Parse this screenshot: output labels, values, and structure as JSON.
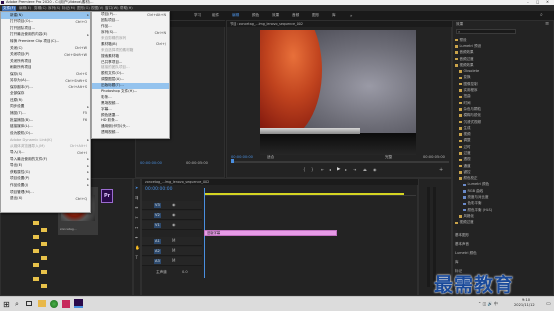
{
  "titlebar": {
    "title": "Adobe Premiere Pro 2020 - C:\\用户\\Videos\\素材\\..."
  },
  "menubar": {
    "items": [
      "文件(F)",
      "编辑(E)",
      "剪辑(C)",
      "序列(S)",
      "标记(M)",
      "图形(G)",
      "视图(V)",
      "窗口(W)",
      "帮助(H)"
    ]
  },
  "workspaces": [
    "学习",
    "组件",
    "编辑",
    "颜色",
    "效果",
    "音频",
    "图形",
    "库"
  ],
  "file_menu": {
    "items": [
      {
        "label": "新建(N)",
        "shortcut": "",
        "arrow": true,
        "hl": true
      },
      {
        "label": "打开项目(O)...",
        "shortcut": "Ctrl+O"
      },
      {
        "label": "打开团队项目...",
        "shortcut": ""
      },
      {
        "label": "打开最近使用的内容(E)",
        "shortcut": "",
        "arrow": true
      },
      {
        "label": "转换 Premiere Clip 项目(C)...",
        "shortcut": ""
      },
      {
        "label": "关闭(C)",
        "shortcut": "Ctrl+W"
      },
      {
        "label": "关闭项目(P)",
        "shortcut": "Ctrl+Shift+W"
      },
      {
        "label": "关闭所有项目",
        "shortcut": ""
      },
      {
        "label": "刷新所有项目",
        "shortcut": ""
      },
      {
        "label": "保存(S)",
        "shortcut": "Ctrl+S"
      },
      {
        "label": "另存为(A)...",
        "shortcut": "Ctrl+Shift+S"
      },
      {
        "label": "保存副本(Y)...",
        "shortcut": "Ctrl+Alt+S"
      },
      {
        "label": "全部保存",
        "shortcut": ""
      },
      {
        "label": "还原(R)",
        "shortcut": ""
      },
      {
        "label": "同步设置",
        "shortcut": "",
        "arrow": true
      },
      {
        "label": "捕捉(T)...",
        "shortcut": "F5"
      },
      {
        "label": "批量捕捉(B)...",
        "shortcut": "F6"
      },
      {
        "label": "链接媒体(L)...",
        "shortcut": ""
      },
      {
        "label": "设为脱机(O)...",
        "shortcut": ""
      },
      {
        "label": "Adobe Dynamic Link(K)",
        "shortcut": "",
        "arrow": true,
        "disabled": true
      },
      {
        "label": "从媒体浏览器导入(M)",
        "shortcut": "Ctrl+Alt+I",
        "disabled": true
      },
      {
        "label": "导入(I)...",
        "shortcut": "Ctrl+I"
      },
      {
        "label": "导入最近使用的文件(F)",
        "shortcut": "",
        "arrow": true
      },
      {
        "label": "导出(E)",
        "shortcut": "",
        "arrow": true
      },
      {
        "label": "获取属性(G)",
        "shortcut": "",
        "arrow": true
      },
      {
        "label": "项目设置(P)",
        "shortcut": "",
        "arrow": true
      },
      {
        "label": "作品设置(J)",
        "shortcut": "",
        "arrow": true
      },
      {
        "label": "项目管理(M)...",
        "shortcut": ""
      },
      {
        "label": "退出(X)",
        "shortcut": "Ctrl+Q"
      }
    ]
  },
  "new_submenu": {
    "items": [
      {
        "label": "项目(P)...",
        "shortcut": "Ctrl+Alt+N"
      },
      {
        "label": "团队项目...",
        "shortcut": ""
      },
      {
        "label": "作品...",
        "shortcut": ""
      },
      {
        "label": "序列(S)...",
        "shortcut": "Ctrl+N"
      },
      {
        "label": "来自剪辑的序列",
        "shortcut": "",
        "disabled": true
      },
      {
        "label": "素材箱(B)",
        "shortcut": "Ctrl+/"
      },
      {
        "label": "来自选择项的素材箱",
        "shortcut": "",
        "disabled": true
      },
      {
        "label": "搜索素材箱",
        "shortcut": ""
      },
      {
        "label": "已共享项目...",
        "shortcut": ""
      },
      {
        "label": "链接的团队项目...",
        "shortcut": "",
        "disabled": true
      },
      {
        "label": "脱机文件(O)...",
        "shortcut": ""
      },
      {
        "label": "调整图层(A)...",
        "shortcut": ""
      },
      {
        "label": "旧版标题(T)...",
        "shortcut": "",
        "hl": true
      },
      {
        "label": "Photoshop 文件(H)...",
        "shortcut": ""
      },
      {
        "label": "彩条...",
        "shortcut": ""
      },
      {
        "label": "黑场视频...",
        "shortcut": ""
      },
      {
        "label": "字幕...",
        "shortcut": ""
      },
      {
        "label": "颜色遮罩...",
        "shortcut": ""
      },
      {
        "label": "HD 彩条...",
        "shortcut": ""
      },
      {
        "label": "通用倒计时片头...",
        "shortcut": ""
      },
      {
        "label": "透明视频...",
        "shortcut": ""
      }
    ]
  },
  "program_monitor": {
    "tab": "节目: zoncetag_...lmg_lenovo_sequence_002",
    "timecode_left": "00:00:00:00",
    "timecode_right": "00:00:05:00",
    "fit_label": "适合",
    "quality_label": "完整"
  },
  "source_monitor": {
    "timecode_left": "00:00:00:00",
    "timecode_right": "00:00:05:00"
  },
  "effects_panel": {
    "tab": "效果",
    "search_placeholder": "",
    "tree": [
      {
        "label": "预设",
        "indent": 0
      },
      {
        "label": "Lumetri 预设",
        "indent": 0
      },
      {
        "label": "音频效果",
        "indent": 0
      },
      {
        "label": "音频过渡",
        "indent": 0
      },
      {
        "label": "视频效果",
        "indent": 0
      },
      {
        "label": "Obsolete",
        "indent": 1
      },
      {
        "label": "变换",
        "indent": 1
      },
      {
        "label": "图像控制",
        "indent": 1
      },
      {
        "label": "实用程序",
        "indent": 1
      },
      {
        "label": "扭曲",
        "indent": 1
      },
      {
        "label": "时间",
        "indent": 1
      },
      {
        "label": "杂色与颗粒",
        "indent": 1
      },
      {
        "label": "模糊与锐化",
        "indent": 1
      },
      {
        "label": "沉浸式视频",
        "indent": 1
      },
      {
        "label": "生成",
        "indent": 1
      },
      {
        "label": "视频",
        "indent": 1
      },
      {
        "label": "调整",
        "indent": 1
      },
      {
        "label": "过时",
        "indent": 1
      },
      {
        "label": "过渡",
        "indent": 1
      },
      {
        "label": "透视",
        "indent": 1
      },
      {
        "label": "通道",
        "indent": 1
      },
      {
        "label": "键控",
        "indent": 1
      },
      {
        "label": "颜色校正",
        "indent": 1
      },
      {
        "label": "Lumetri 颜色",
        "indent": 2
      },
      {
        "label": "RGB 曲线",
        "indent": 2
      },
      {
        "label": "亮度与对比度",
        "indent": 2
      },
      {
        "label": "色彩平衡",
        "indent": 2
      },
      {
        "label": "颜色平衡 (HLS)",
        "indent": 2
      },
      {
        "label": "风格化",
        "indent": 1
      },
      {
        "label": "视频过渡",
        "indent": 0
      }
    ],
    "bottom_items": [
      "基本图形",
      "基本声音",
      "Lumetri 颜色",
      "库",
      "标记",
      "历史记录",
      "信息"
    ]
  },
  "project_panel": {
    "thumb_label": "Adobe Premiere...",
    "clip_name": "zoncetag...",
    "folder_count": 10
  },
  "timeline": {
    "tab": "zoncetag_...lmg_lenovo_sequence_002",
    "timecode": "00:00:00:00",
    "clip_label": "旧版字幕",
    "tracks": [
      "V3",
      "V2",
      "V1",
      "A1",
      "A2",
      "A3"
    ],
    "master": "主声道",
    "master_value": "0.0"
  },
  "taskbar": {
    "time": "9:10",
    "date": "2021/11/12"
  },
  "watermark": {
    "text": "最需教育"
  }
}
